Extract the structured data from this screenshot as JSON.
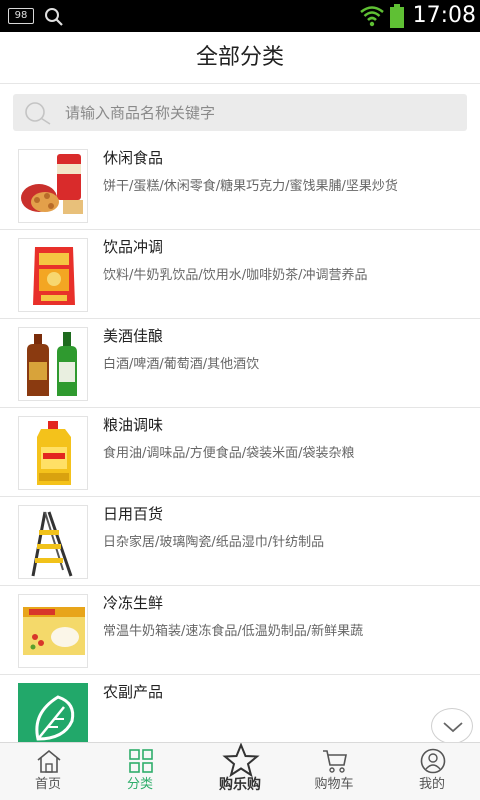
{
  "status_bar": {
    "badge": "98",
    "time": "17:08"
  },
  "header": {
    "title": "全部分类"
  },
  "search": {
    "placeholder": "请输入商品名称关键字"
  },
  "categories": [
    {
      "title": "休闲食品",
      "subtitle": "饼干/蛋糕/休闲零食/糖果巧克力/蜜饯果脯/坚果炒货"
    },
    {
      "title": "饮品冲调",
      "subtitle": "饮料/牛奶乳饮品/饮用水/咖啡奶茶/冲调营养品"
    },
    {
      "title": "美酒佳酿",
      "subtitle": "白酒/啤酒/葡萄酒/其他酒饮"
    },
    {
      "title": "粮油调味",
      "subtitle": "食用油/调味品/方便食品/袋装米面/袋装杂粮"
    },
    {
      "title": "日用百货",
      "subtitle": "日杂家居/玻璃陶瓷/纸品湿巾/针纺制品"
    },
    {
      "title": "冷冻生鲜",
      "subtitle": "常温牛奶箱装/速冻食品/低温奶制品/新鲜果蔬"
    },
    {
      "title": "农副产品",
      "subtitle": ""
    }
  ],
  "tabs": [
    {
      "label": "首页"
    },
    {
      "label": "分类"
    },
    {
      "label": "购乐购"
    },
    {
      "label": "购物车"
    },
    {
      "label": "我的"
    }
  ],
  "colors": {
    "accent": "#2fae6b",
    "battery": "#5fc034"
  }
}
